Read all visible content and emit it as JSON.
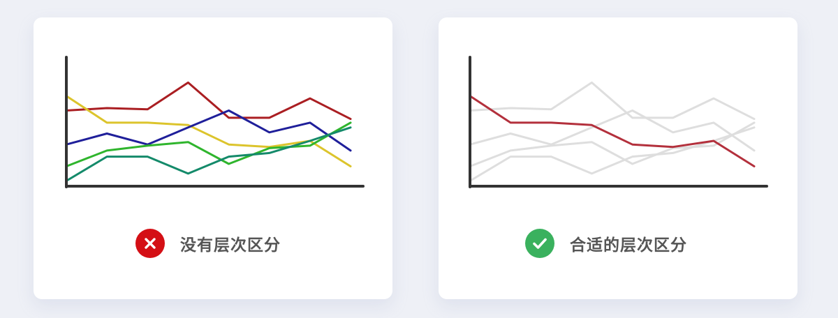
{
  "colors": {
    "background": "#eef0f6",
    "card": "#ffffff",
    "axis": "#333333",
    "muted_line": "#dedede",
    "highlight_line": "#b3303c",
    "bad_badge": "#d40f15",
    "good_badge": "#3ab15e",
    "caption_text": "#555555"
  },
  "panels": [
    {
      "caption": "没有层次区分",
      "badge": {
        "icon": "close-icon",
        "color": "#d40f15"
      }
    },
    {
      "caption": "合适的层次区分",
      "badge": {
        "icon": "check-icon",
        "color": "#3ab15e"
      }
    }
  ],
  "chart_data": [
    {
      "type": "line",
      "title": "",
      "xlabel": "",
      "ylabel": "",
      "x": [
        1,
        2,
        3,
        4,
        5,
        6,
        7,
        8
      ],
      "ylim": [
        0,
        100
      ],
      "grid": false,
      "legend": "none",
      "series": [
        {
          "color": "#aa1e22",
          "values": [
            71,
            73,
            72,
            94,
            65,
            65,
            81,
            64
          ]
        },
        {
          "color": "#dcc42c",
          "values": [
            83,
            61,
            61,
            59,
            43,
            41,
            46,
            25
          ]
        },
        {
          "color": "#1f1f9a",
          "values": [
            43,
            52,
            43,
            57,
            71,
            53,
            61,
            38
          ]
        },
        {
          "color": "#2fb52d",
          "values": [
            25,
            38,
            42,
            45,
            27,
            40,
            42,
            61
          ]
        },
        {
          "color": "#148a6a",
          "values": [
            13,
            33,
            33,
            19,
            33,
            36,
            46,
            57
          ]
        }
      ]
    },
    {
      "type": "line",
      "title": "",
      "xlabel": "",
      "ylabel": "",
      "x": [
        1,
        2,
        3,
        4,
        5,
        6,
        7,
        8
      ],
      "ylim": [
        0,
        100
      ],
      "grid": false,
      "legend": "none",
      "highlight_index": 1,
      "series": [
        {
          "color": "#dedede",
          "values": [
            71,
            73,
            72,
            94,
            65,
            65,
            81,
            64
          ]
        },
        {
          "color": "#b3303c",
          "values": [
            83,
            61,
            61,
            59,
            43,
            41,
            46,
            25
          ]
        },
        {
          "color": "#dedede",
          "values": [
            43,
            52,
            43,
            57,
            71,
            53,
            61,
            38
          ]
        },
        {
          "color": "#dedede",
          "values": [
            25,
            38,
            42,
            45,
            27,
            40,
            42,
            61
          ]
        },
        {
          "color": "#dedede",
          "values": [
            13,
            33,
            33,
            19,
            33,
            36,
            46,
            57
          ]
        }
      ]
    }
  ]
}
